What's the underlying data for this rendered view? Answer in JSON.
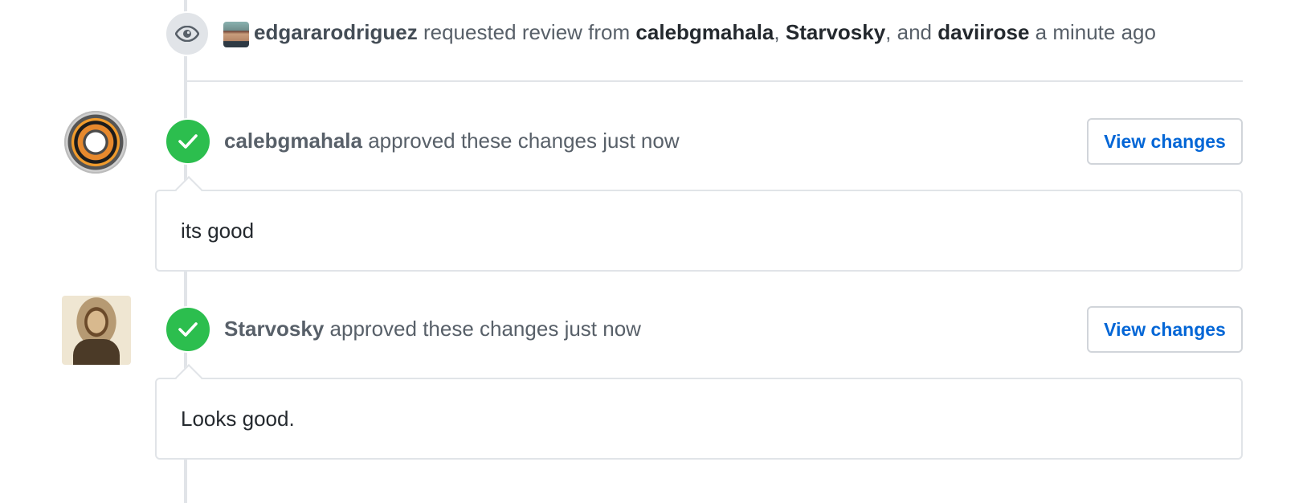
{
  "review_request": {
    "actor": "edgararodriguez",
    "action_text": "requested review from",
    "reviewers": [
      "calebgmahala",
      "Starvosky",
      "daviirose"
    ],
    "separator": ", ",
    "and_text": ", and",
    "time": "a minute ago",
    "icon": "eye-icon"
  },
  "reviews": [
    {
      "author": "calebgmahala",
      "action": "approved these changes",
      "time": "just now",
      "button_label": "View changes",
      "comment": "its good",
      "status_icon": "check-icon",
      "status_color": "#2cbe4e"
    },
    {
      "author": "Starvosky",
      "action": "approved these changes",
      "time": "just now",
      "button_label": "View changes",
      "comment": "Looks good.",
      "status_icon": "check-icon",
      "status_color": "#2cbe4e"
    }
  ],
  "colors": {
    "link": "#0366d6",
    "text_muted": "#586069",
    "text_dark": "#24292e",
    "border": "#e1e4e8"
  }
}
